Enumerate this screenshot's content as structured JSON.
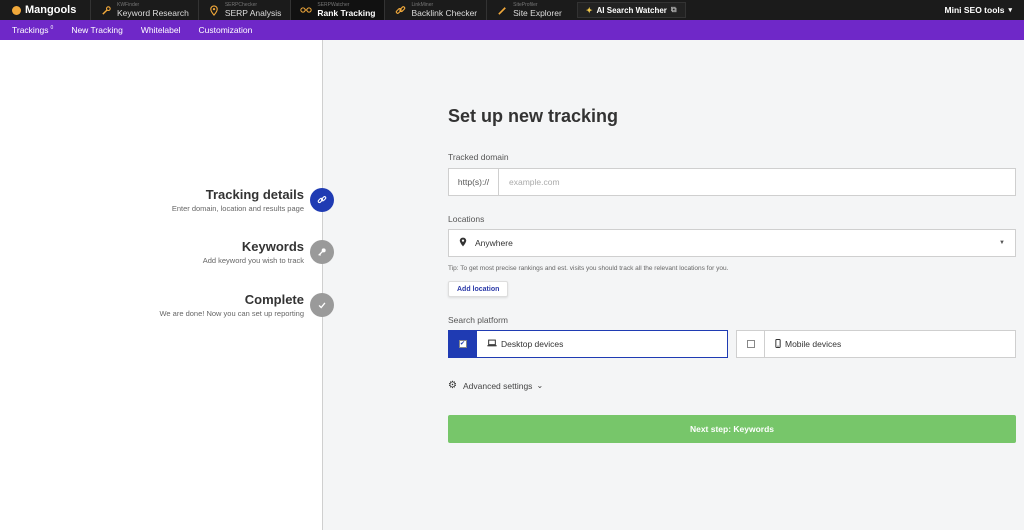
{
  "topbar": {
    "logo": "Mangools",
    "apps": [
      {
        "small": "KWFinder",
        "label": "Keyword Research",
        "icon": "magnifier-icon"
      },
      {
        "small": "SERPChecker",
        "label": "SERP Analysis",
        "icon": "pin-icon"
      },
      {
        "small": "SERPWatcher",
        "label": "Rank Tracking",
        "icon": "glasses-icon",
        "active": true
      },
      {
        "small": "LinkMiner",
        "label": "Backlink Checker",
        "icon": "link-icon"
      },
      {
        "small": "SiteProfiler",
        "label": "Site Explorer",
        "icon": "wand-icon"
      }
    ],
    "ai_button": "AI Search Watcher",
    "mini_tools": "Mini SEO tools"
  },
  "subnav": {
    "trackings": "Trackings",
    "trackings_count": "0",
    "new_tracking": "New Tracking",
    "whitelabel": "Whitelabel",
    "customization": "Customization"
  },
  "steps": [
    {
      "title": "Tracking details",
      "desc": "Enter domain, location and results page",
      "icon": "link-icon"
    },
    {
      "title": "Keywords",
      "desc": "Add keyword you wish to track",
      "icon": "key-icon"
    },
    {
      "title": "Complete",
      "desc": "We are done! Now you can set up reporting",
      "icon": "check-icon"
    }
  ],
  "form": {
    "heading": "Set up new tracking",
    "domain_label": "Tracked domain",
    "domain_prefix": "http(s)://",
    "domain_placeholder": "example.com",
    "locations_label": "Locations",
    "location_value": "Anywhere",
    "tip": "Tip: To get most precise rankings and est. visits you should track all the relevant locations for you.",
    "add_location": "Add location",
    "platform_label": "Search platform",
    "desktop": "Desktop devices",
    "mobile": "Mobile devices",
    "advanced": "Advanced settings",
    "next": "Next step: Keywords"
  },
  "colors": {
    "topbar": "#1b1b1b",
    "subnav": "#6f28c8",
    "active_step": "#1f3bb3",
    "inactive_step": "#9a9a9a",
    "next_button": "#77c66a"
  }
}
